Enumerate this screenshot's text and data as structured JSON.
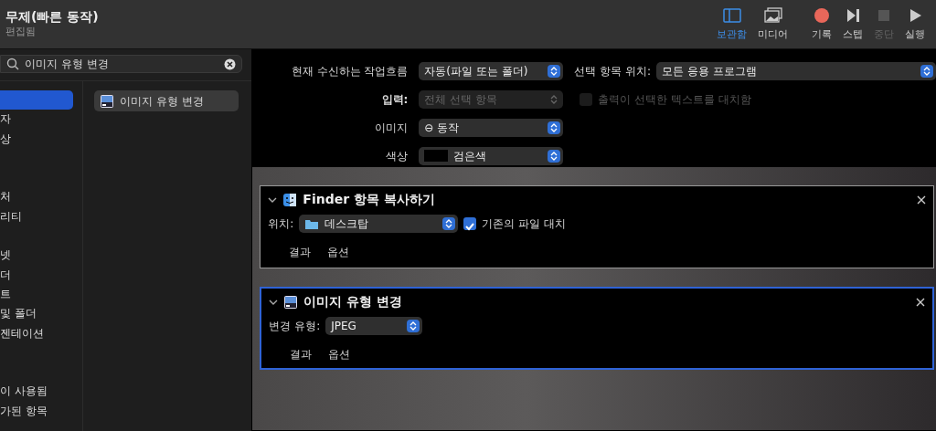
{
  "window": {
    "title": "무제(빠른 동작)",
    "subtitle": "편집됨"
  },
  "toolbar": [
    {
      "label": "보관함",
      "kind": "library",
      "selected": true,
      "disabled": false
    },
    {
      "label": "미디어",
      "kind": "media",
      "selected": false,
      "disabled": false
    },
    {
      "label": "기록",
      "kind": "record",
      "selected": false,
      "disabled": false
    },
    {
      "label": "스텝",
      "kind": "step",
      "selected": false,
      "disabled": false
    },
    {
      "label": "중단",
      "kind": "stop",
      "selected": false,
      "disabled": true
    },
    {
      "label": "실행",
      "kind": "run",
      "selected": false,
      "disabled": false
    }
  ],
  "search": {
    "value": "이미지 유형 변경"
  },
  "categories": [
    {
      "selected": true
    },
    {
      "label": "자",
      "selected": false
    },
    {
      "label": "상",
      "selected": false
    },
    {
      "selected": false
    },
    {
      "selected": false
    },
    {
      "label": "처",
      "selected": false
    },
    {
      "label": "리티",
      "selected": false
    },
    {
      "selected": false
    },
    {
      "label": "넷",
      "selected": false
    },
    {
      "label": "더",
      "selected": false
    },
    {
      "label": "트",
      "selected": false
    },
    {
      "label": "및 폴더",
      "selected": false
    },
    {
      "label": "젠테이션",
      "selected": false
    },
    {
      "selected": false
    },
    {
      "selected": false
    },
    {
      "label": "이 사용됨",
      "selected": false
    },
    {
      "label": "가된 항목",
      "selected": false
    }
  ],
  "actions": [
    {
      "label": "이미지 유형 변경",
      "selected": true
    }
  ],
  "workflow_settings": {
    "receives": {
      "label": "현재 수신하는 작업흐름",
      "value": "자동(파일 또는 폴더)"
    },
    "location": {
      "label": "선택 항목 위치:",
      "value": "모든 응용 프로그램"
    },
    "input": {
      "label": "입력:",
      "value": "전체 선택 항목",
      "disabled": true
    },
    "replace": {
      "label": "출력이 선택한 텍스트를 대치함",
      "checked": false,
      "disabled": true
    },
    "image": {
      "label": "이미지",
      "value": "⊖ 동작"
    },
    "color": {
      "label": "색상",
      "value": "검은색"
    }
  },
  "steps": [
    {
      "title": "Finder 항목 복사하기",
      "kind": "finder",
      "selected": false,
      "field_label": "위치:",
      "field_value": "데스크탑",
      "checkbox": {
        "label": "기존의 파일 대치",
        "checked": true
      },
      "tabs": [
        "결과",
        "옵션"
      ]
    },
    {
      "title": "이미지 유형 변경",
      "kind": "image",
      "selected": true,
      "field_label": "변경 유형:",
      "field_value": "JPEG",
      "tabs": [
        "결과",
        "옵션"
      ]
    }
  ]
}
